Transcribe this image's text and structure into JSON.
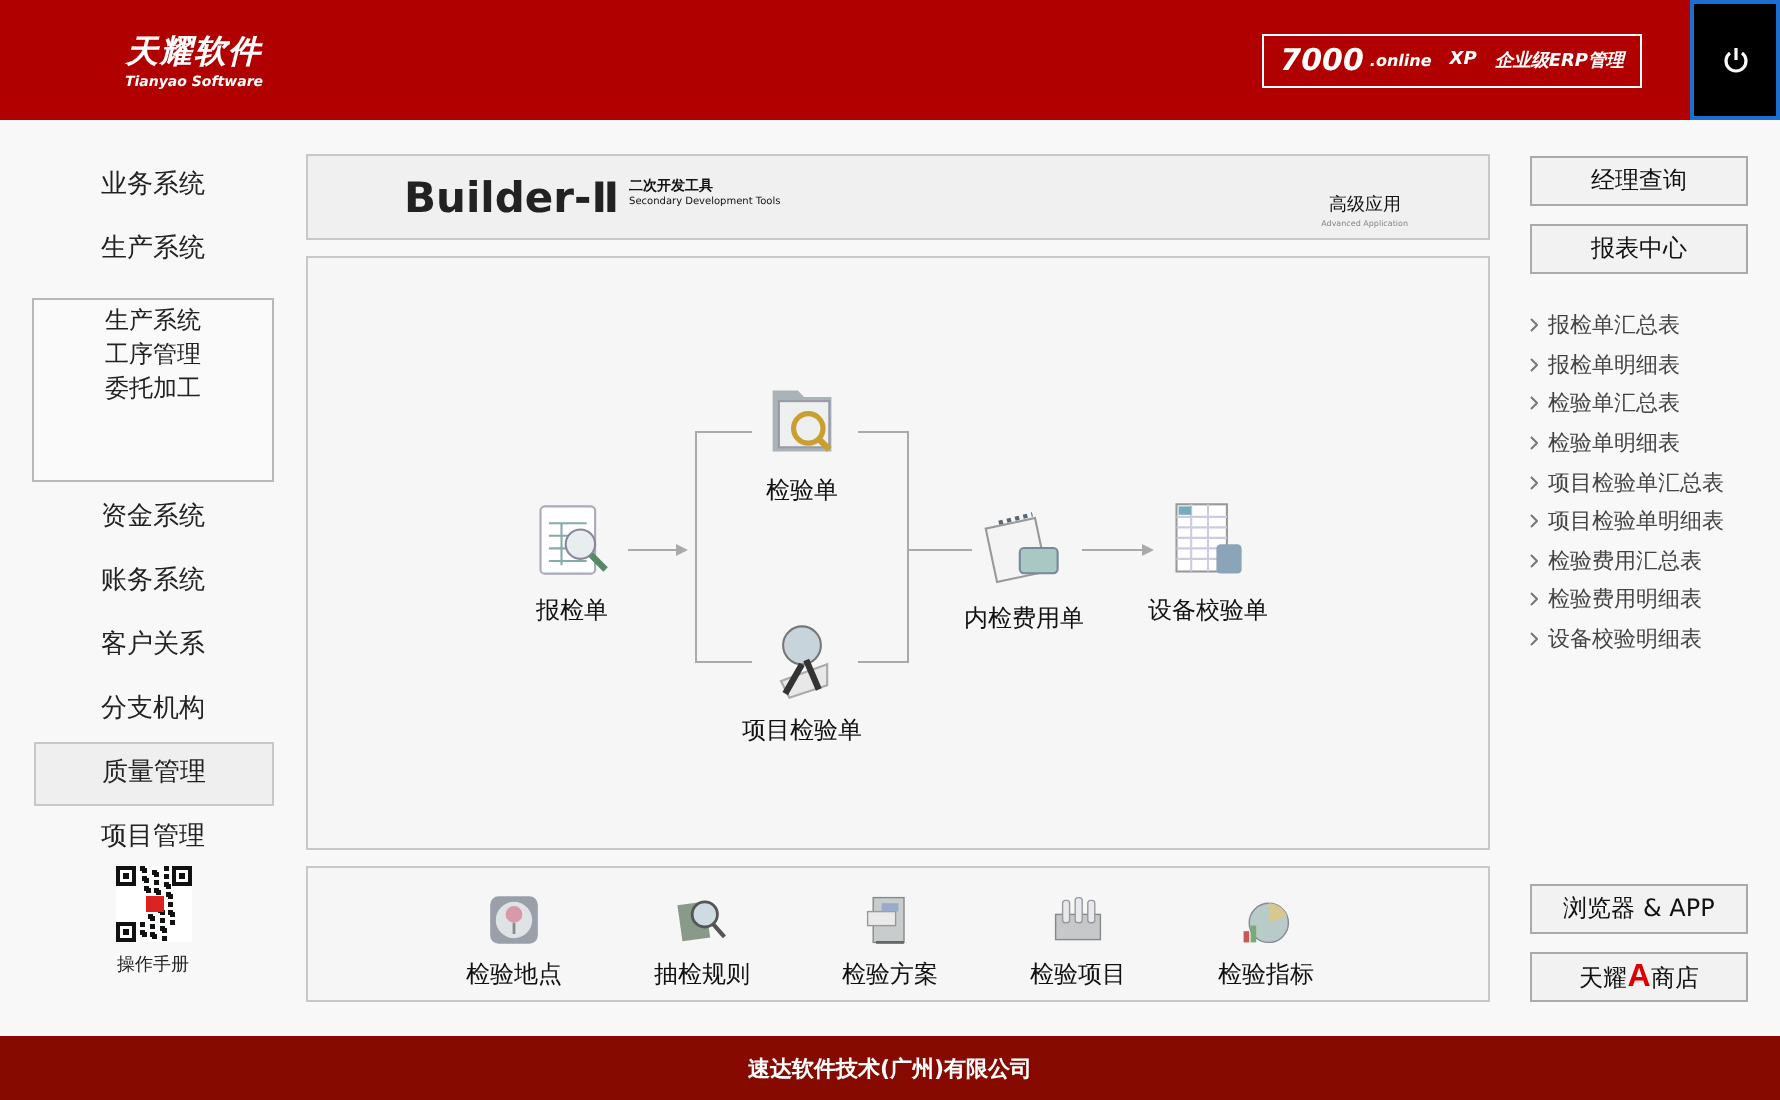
{
  "header": {
    "logo": {
      "name": "天耀软件",
      "subtitle": "Tianyao Software"
    },
    "edition": {
      "number": "7000",
      "suffix": ".online",
      "xp": "XP",
      "label": "企业级ERP管理"
    }
  },
  "left_nav": [
    {
      "kind": "item",
      "label": "业务系统",
      "selected": false
    },
    {
      "kind": "item",
      "label": "生产系统",
      "selected": false
    },
    {
      "kind": "group",
      "children": [
        {
          "label": "生产系统",
          "selected": false
        },
        {
          "label": "工序管理",
          "selected": false
        },
        {
          "label": "委托加工",
          "selected": false
        }
      ]
    },
    {
      "kind": "item",
      "label": "资金系统",
      "selected": false
    },
    {
      "kind": "item",
      "label": "账务系统",
      "selected": false
    },
    {
      "kind": "item",
      "label": "客户关系",
      "selected": false
    },
    {
      "kind": "item",
      "label": "分支机构",
      "selected": false
    },
    {
      "kind": "item",
      "label": "质量管理",
      "selected": true
    },
    {
      "kind": "item",
      "label": "项目管理",
      "selected": false
    }
  ],
  "manual": {
    "label": "操作手册"
  },
  "banner": {
    "title": "Builder-Ⅱ",
    "subtitle": "二次开发工具",
    "subtitle_en": "Secondary Development Tools",
    "right_title": "高级应用",
    "right_subtitle": "Advanced Application"
  },
  "flow": {
    "nodes": [
      {
        "label": "报检单",
        "kind": "form"
      },
      {
        "label": "检验单",
        "kind": "folder"
      },
      {
        "label": "项目检验单",
        "kind": "inspect"
      },
      {
        "label": "内检费用单",
        "kind": "notebook"
      },
      {
        "label": "设备校验单",
        "kind": "spreadsheet"
      }
    ]
  },
  "tools": [
    {
      "label": "检验地点",
      "kind": "location"
    },
    {
      "label": "抽检规则",
      "kind": "sampling"
    },
    {
      "label": "检验方案",
      "kind": "plan"
    },
    {
      "label": "检验项目",
      "kind": "items"
    },
    {
      "label": "检验指标",
      "kind": "indicator"
    }
  ],
  "right": {
    "buttons": [
      "经理查询",
      "报表中心"
    ],
    "reports": [
      "报检单汇总表",
      "报检单明细表",
      "检验单汇总表",
      "检验单明细表",
      "项目检验单汇总表",
      "项目检验单明细表",
      "检验费用汇总表",
      "检验费用明细表",
      "设备校验明细表"
    ],
    "app_button": "浏览器 & APP",
    "store_button": {
      "before": "天耀",
      "mark": "A",
      "after": "商店"
    }
  },
  "footer": {
    "text": "速达软件技术(广州)有限公司"
  }
}
